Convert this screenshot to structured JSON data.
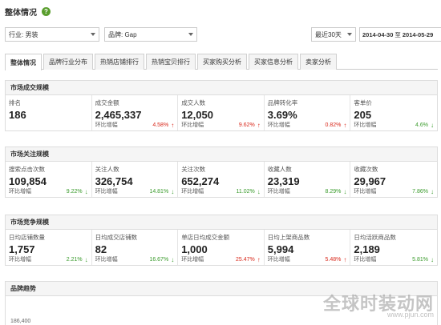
{
  "header": {
    "title": "整体情况",
    "help_icon": "?"
  },
  "filters": {
    "industry": "行业: 男装",
    "brand": "品牌: Gap",
    "period": "最近30天",
    "date_start": "2014-04-30",
    "date_sep": "至",
    "date_end": "2014-05-29"
  },
  "tabs": [
    "整体情况",
    "品牌行业分布",
    "热销店铺排行",
    "热销宝贝排行",
    "买家购买分析",
    "买家信息分析",
    "卖家分析"
  ],
  "change_label": "环比增幅",
  "sections": [
    {
      "title": "市场成交规模",
      "metrics": [
        {
          "label": "排名",
          "value": "186",
          "change": "",
          "direction": ""
        },
        {
          "label": "成交金额",
          "value": "2,465,337",
          "change": "4.58%",
          "direction": "up"
        },
        {
          "label": "成交人数",
          "value": "12,050",
          "change": "9.62%",
          "direction": "up"
        },
        {
          "label": "品牌转化率",
          "value": "3.69%",
          "change": "0.82%",
          "direction": "up"
        },
        {
          "label": "客单价",
          "value": "205",
          "change": "4.6%",
          "direction": "down"
        }
      ]
    },
    {
      "title": "市场关注规模",
      "metrics": [
        {
          "label": "搜索点击次数",
          "value": "109,854",
          "change": "9.22%",
          "direction": "down"
        },
        {
          "label": "关注人数",
          "value": "326,754",
          "change": "14.81%",
          "direction": "down"
        },
        {
          "label": "关注次数",
          "value": "652,274",
          "change": "11.02%",
          "direction": "down"
        },
        {
          "label": "收藏人数",
          "value": "23,319",
          "change": "8.29%",
          "direction": "down"
        },
        {
          "label": "收藏次数",
          "value": "29,967",
          "change": "7.86%",
          "direction": "down"
        }
      ]
    },
    {
      "title": "市场竞争规模",
      "metrics": [
        {
          "label": "日均店铺数量",
          "value": "1,757",
          "change": "2.21%",
          "direction": "down"
        },
        {
          "label": "日均成交店铺数",
          "value": "82",
          "change": "16.67%",
          "direction": "down"
        },
        {
          "label": "单店日均成交金额",
          "value": "1,000",
          "change": "25.47%",
          "direction": "up"
        },
        {
          "label": "日均上架商品数",
          "value": "5,994",
          "change": "5.48%",
          "direction": "up"
        },
        {
          "label": "日均活跃商品数",
          "value": "2,189",
          "change": "5.81%",
          "direction": "down"
        }
      ]
    }
  ],
  "trend": {
    "title": "品牌趋势",
    "axis_top": "186,400"
  },
  "watermark": {
    "text": "全球时装动网",
    "sub": "www.pjun.com"
  },
  "colors": {
    "up": "#d9291c",
    "down": "#3a9b2c",
    "help": "#5a9e2e"
  }
}
